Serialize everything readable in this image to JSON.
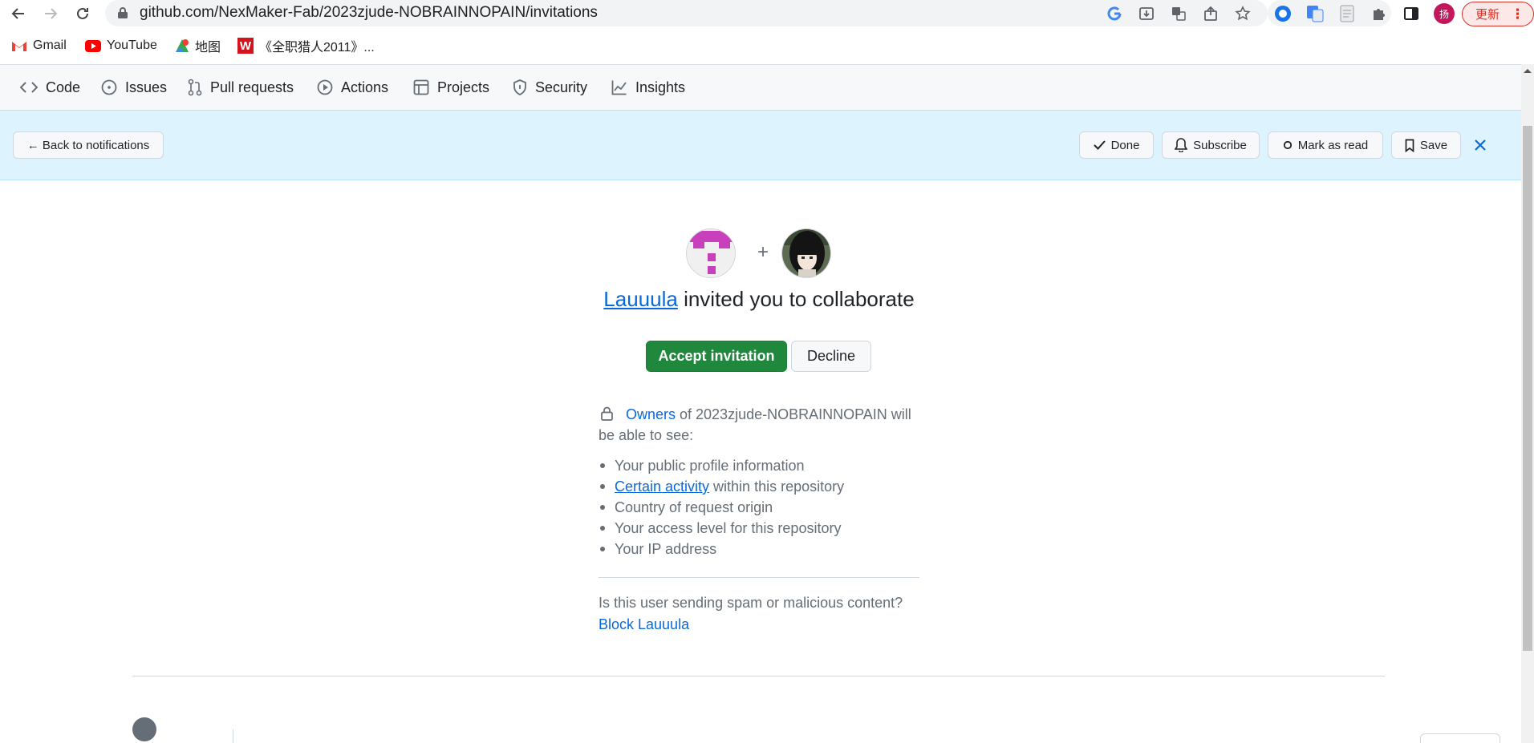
{
  "browser": {
    "url": "github.com/NexMaker-Fab/2023zjude-NOBRAINNOPAIN/invitations",
    "update_label": "更新",
    "profile_initial": "扬"
  },
  "bookmarks": [
    {
      "label": "Gmail",
      "icon": "gmail-icon"
    },
    {
      "label": "YouTube",
      "icon": "youtube-icon"
    },
    {
      "label": "地图",
      "icon": "maps-icon"
    },
    {
      "label": "《全职猎人2011》...",
      "icon": "w-icon"
    }
  ],
  "repo_nav": {
    "tabs": [
      {
        "label": "Code",
        "icon": "code-icon"
      },
      {
        "label": "Issues",
        "icon": "issues-icon"
      },
      {
        "label": "Pull requests",
        "icon": "pull-request-icon"
      },
      {
        "label": "Actions",
        "icon": "play-icon"
      },
      {
        "label": "Projects",
        "icon": "table-icon"
      },
      {
        "label": "Security",
        "icon": "shield-icon"
      },
      {
        "label": "Insights",
        "icon": "graph-icon"
      }
    ]
  },
  "notification_bar": {
    "back_label": "← Back to notifications",
    "done_label": "Done",
    "subscribe_label": "Subscribe",
    "mark_read_label": "Mark as read",
    "save_label": "Save"
  },
  "invitation": {
    "plus": "+",
    "inviter": "Lauuula",
    "heading_rest": " invited you to collaborate",
    "accept_label": "Accept invitation",
    "decline_label": "Decline",
    "owners_link": "Owners",
    "owners_rest": " of 2023zjude-NOBRAINNOPAIN will be able to see:",
    "permissions": [
      {
        "text": "Your public profile information"
      },
      {
        "link": "Certain activity",
        "text": " within this repository"
      },
      {
        "text": "Country of request origin"
      },
      {
        "text": "Your access level for this repository"
      },
      {
        "text": "Your IP address"
      }
    ],
    "spam_question": "Is this user sending spam or malicious content?",
    "block_label": "Block Lauuula"
  },
  "colors": {
    "accent": "#0969da",
    "accept_green": "#1f883d",
    "notification_bg": "#ddf4ff"
  }
}
